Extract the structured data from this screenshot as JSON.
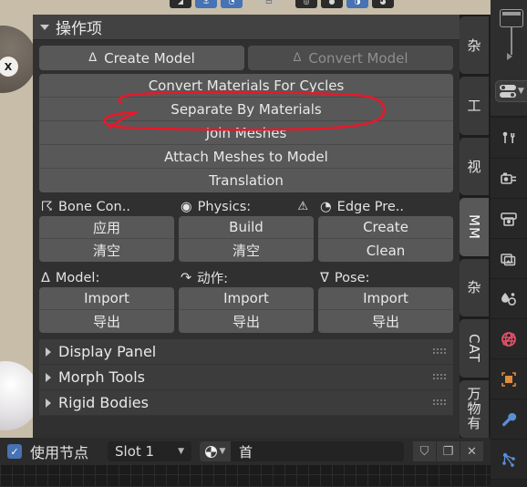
{
  "viewport": {
    "name": "3d-viewport",
    "x_badge": "X",
    "header_buttons": [
      {
        "name": "select-tool",
        "glyph": "◢",
        "state": "off"
      },
      {
        "name": "snap-magnet",
        "glyph": "⚓",
        "state": "on"
      },
      {
        "name": "proportional-edit",
        "glyph": "◔",
        "state": "on"
      },
      {
        "name": "viewport-overlay",
        "glyph": "▭",
        "state": "light"
      },
      {
        "name": "shading-wireframe",
        "glyph": "◎",
        "state": "off"
      },
      {
        "name": "shading-solid",
        "glyph": "●",
        "state": "off"
      },
      {
        "name": "shading-material",
        "glyph": "◑",
        "state": "on"
      },
      {
        "name": "shading-rendered",
        "glyph": "◕",
        "state": "off"
      }
    ]
  },
  "panel": {
    "title": "操作项",
    "model_row": [
      {
        "label": "Create Model",
        "icon": "armature-icon",
        "icon_glyph": "ᐃ",
        "disabled": false
      },
      {
        "label": "Convert Model",
        "icon": "armature-icon",
        "icon_glyph": "ᐃ",
        "disabled": true
      }
    ],
    "action_buttons": [
      "Convert Materials For Cycles",
      "Separate By Materials",
      "Join Meshes",
      "Attach Meshes to Model",
      "Translation"
    ],
    "groups": [
      {
        "title": "Bone Con..",
        "icon": "bone-constraint-icon",
        "icon_glyph": "☈",
        "warning": "",
        "buttons": [
          "应用",
          "清空"
        ]
      },
      {
        "title": "Physics:",
        "icon": "physics-icon",
        "icon_glyph": "◉",
        "warning": "⚠",
        "buttons": [
          "Build",
          "清空"
        ]
      },
      {
        "title": "Edge Pre..",
        "icon": "edge-preview-icon",
        "icon_glyph": "◔",
        "warning": "",
        "buttons": [
          "Create",
          "Clean"
        ]
      }
    ],
    "io_groups": [
      {
        "title": "Model:",
        "icon": "armature-icon",
        "icon_glyph": "ᐃ",
        "buttons": [
          "Import",
          "导出"
        ]
      },
      {
        "title": "动作:",
        "icon": "action-icon",
        "icon_glyph": "↷",
        "buttons": [
          "Import",
          "导出"
        ]
      },
      {
        "title": "Pose:",
        "icon": "pose-icon",
        "icon_glyph": "ᐁ",
        "buttons": [
          "Import",
          "导出"
        ]
      }
    ],
    "subpanels": [
      "Display Panel",
      "Morph Tools",
      "Rigid Bodies"
    ]
  },
  "annotation": {
    "name": "red-circle-annotation",
    "target": "Separate By Materials",
    "color": "#e8182a"
  },
  "vertical_tabs": [
    {
      "label": "杂",
      "active": false,
      "vertical": true
    },
    {
      "label": "工",
      "active": false,
      "vertical": true
    },
    {
      "label": "视",
      "active": false,
      "vertical": true
    },
    {
      "label": "MM",
      "active": true,
      "vertical": false
    },
    {
      "label": "杂",
      "active": false,
      "vertical": true
    },
    {
      "label": "CAT",
      "active": false,
      "vertical": false
    },
    {
      "label": "万物有",
      "active": false,
      "vertical": true
    }
  ],
  "bottom_bar": {
    "use_nodes_checked": true,
    "use_nodes_label": "使用节点",
    "slot_value": "Slot 1",
    "material_name": "首",
    "buttons": [
      {
        "name": "fake-user-shield-button",
        "glyph": "⛉"
      },
      {
        "name": "duplicate-material-button",
        "glyph": "❐"
      },
      {
        "name": "unlink-material-button",
        "glyph": "✕"
      }
    ]
  },
  "properties_tabs": [
    {
      "name": "tool-properties-icon",
      "color": "#c9c9c9"
    },
    {
      "name": "render-properties-icon",
      "color": "#c9c9c9"
    },
    {
      "name": "output-properties-icon",
      "color": "#c9c9c9"
    },
    {
      "name": "view-layer-properties-icon",
      "color": "#c9c9c9"
    },
    {
      "name": "scene-properties-icon",
      "color": "#c9c9c9"
    },
    {
      "name": "world-properties-icon",
      "color": "#e2506a"
    },
    {
      "name": "object-properties-icon",
      "color": "#e08c3c"
    },
    {
      "name": "modifier-properties-icon",
      "color": "#5a8fd8"
    },
    {
      "name": "particle-properties-icon",
      "color": "#5a8fd8"
    }
  ]
}
